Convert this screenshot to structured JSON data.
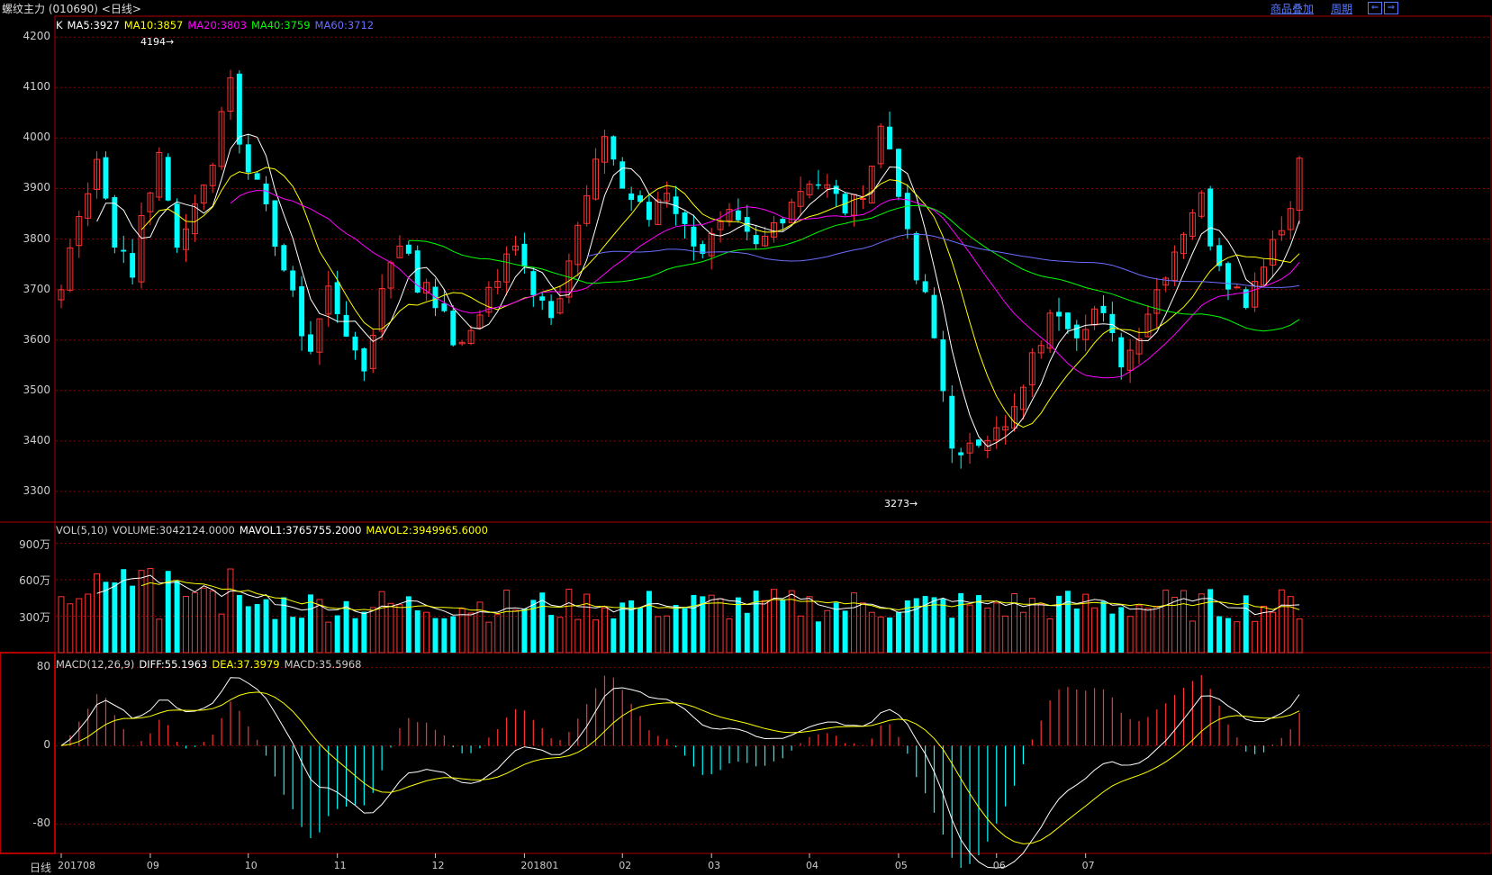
{
  "window": {
    "title": "螺纹主力 (010690) <日线>",
    "buttons": [
      "商品叠加",
      "周期"
    ],
    "icons": [
      "prev-arrow-icon",
      "next-arrow-icon"
    ]
  },
  "price_panel": {
    "legend": [
      {
        "text": "K",
        "color": "#ffffff"
      },
      {
        "text": "MA5:3927",
        "color": "#ffffff"
      },
      {
        "text": "MA10:3857",
        "color": "#ffff00"
      },
      {
        "text": "MA20:3803",
        "color": "#ff00ff"
      },
      {
        "text": "MA40:3759",
        "color": "#00ff00"
      },
      {
        "text": "MA60:3712",
        "color": "#6c6cff"
      }
    ],
    "y_ticks": [
      "4200",
      "4100",
      "4000",
      "3900",
      "3800",
      "3700",
      "3600",
      "3500",
      "3400",
      "3300"
    ],
    "high_marker": "4194",
    "low_marker": "3273"
  },
  "volume_panel": {
    "legend": [
      {
        "text": "VOL(5,10)",
        "color": "#cccccc"
      },
      {
        "text": "VOLUME:3042124.0000",
        "color": "#cccccc"
      },
      {
        "text": "MAVOL1:3765755.2000",
        "color": "#ffffff"
      },
      {
        "text": "MAVOL2:3949965.6000",
        "color": "#ffff00"
      }
    ],
    "y_ticks": [
      "900万",
      "600万",
      "300万"
    ]
  },
  "macd_panel": {
    "legend": [
      {
        "text": "MACD(12,26,9)",
        "color": "#cccccc"
      },
      {
        "text": "DIFF:55.1963",
        "color": "#ffffff"
      },
      {
        "text": "DEA:37.3979",
        "color": "#ffff00"
      },
      {
        "text": "MACD:35.5968",
        "color": "#cccccc"
      }
    ],
    "y_ticks": [
      "80",
      "0",
      "-80"
    ]
  },
  "x_axis": {
    "period_label": "日线",
    "ticks": [
      "201708",
      "09",
      "10",
      "11",
      "12",
      "201801",
      "02",
      "03",
      "04",
      "05",
      "06",
      "07"
    ]
  },
  "colors": {
    "up": "#ff3333",
    "down": "#00ffff",
    "grid": "#8b0000",
    "frame": "#b00000",
    "ma5": "#ffffff",
    "ma10": "#ffff00",
    "ma20": "#ff00ff",
    "ma40": "#00ff00",
    "ma60": "#6c6cff"
  },
  "chart_data": {
    "type": "candlestick",
    "x_ticks": [
      "201708",
      "09",
      "10",
      "11",
      "12",
      "201801",
      "02",
      "03",
      "04",
      "05",
      "06",
      "07"
    ],
    "close_path": [
      3700,
      3780,
      3860,
      3900,
      3960,
      3880,
      3800,
      3760,
      3720,
      3850,
      3900,
      3960,
      3870,
      3800,
      3820,
      3880,
      3900,
      3960,
      4050,
      4120,
      4000,
      3950,
      3900,
      3850,
      3800,
      3740,
      3680,
      3620,
      3580,
      3640,
      3700,
      3660,
      3620,
      3560,
      3540,
      3620,
      3700,
      3760,
      3800,
      3760,
      3700,
      3720,
      3680,
      3640,
      3600,
      3580,
      3620,
      3660,
      3700,
      3720,
      3760,
      3780,
      3760,
      3700,
      3680,
      3660,
      3700,
      3760,
      3820,
      3880,
      3940,
      4010,
      3960,
      3900,
      3880,
      3860,
      3840,
      3880,
      3900,
      3860,
      3820,
      3800,
      3780,
      3800,
      3820,
      3840,
      3820,
      3800,
      3780,
      3800,
      3830,
      3850,
      3880,
      3900,
      3920,
      3910,
      3900,
      3880,
      3860,
      3870,
      3900,
      3950,
      4020,
      3980,
      3900,
      3800,
      3720,
      3680,
      3600,
      3500,
      3400,
      3360,
      3380,
      3400,
      3420,
      3440,
      3420,
      3460,
      3500,
      3560,
      3600,
      3640,
      3660,
      3640,
      3620,
      3640,
      3660,
      3640,
      3600,
      3560,
      3580,
      3620,
      3660,
      3700,
      3740,
      3780,
      3820,
      3860,
      3880,
      3800,
      3760,
      3720,
      3700,
      3680,
      3720,
      3760,
      3800,
      3820,
      3880,
      3950
    ],
    "bar_count": 140,
    "ylim": [
      3250,
      4220
    ],
    "ma_last": {
      "MA5": 3927,
      "MA10": 3857,
      "MA20": 3803,
      "MA40": 3759,
      "MA60": 3712
    },
    "high": 4194,
    "low": 3273,
    "volume_last": {
      "VOLUME": 3042124.0,
      "MAVOL1": 3765755.2,
      "MAVOL2": 3949965.6
    },
    "volume_ylim_wan": [
      0,
      1000
    ],
    "macd_last": {
      "DIFF": 55.1963,
      "DEA": 37.3979,
      "MACD": 35.5968
    },
    "macd_ylim": [
      -110,
      95
    ]
  }
}
